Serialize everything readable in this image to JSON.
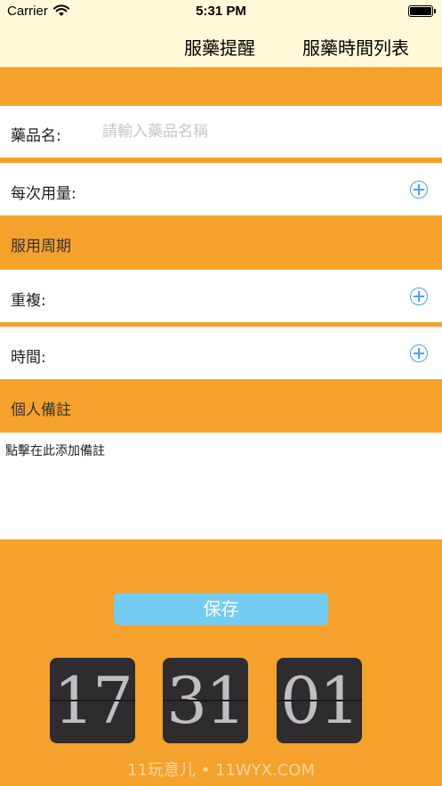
{
  "status_bar": {
    "carrier": "Carrier",
    "time": "5:31 PM"
  },
  "nav": {
    "tab1": "服藥提醒",
    "tab2": "服藥時間列表"
  },
  "form": {
    "name_label": "藥品名:",
    "name_placeholder": "請輸入藥品名稱",
    "name_value": "",
    "dose_label": "每次用量:",
    "period_header": "服用周期",
    "repeat_label": "重複:",
    "time_label": "時間:",
    "notes_header": "個人備註",
    "notes_placeholder": "點擊在此添加備註"
  },
  "save_label": "保存",
  "flip_clock": {
    "hours": "17",
    "minutes": "31",
    "seconds": "01"
  },
  "watermark": "11玩意儿 • 11WYX.COM",
  "colors": {
    "accent": "#f4a22c",
    "nav_bg": "#fff9d9",
    "save_button": "#73cdf3",
    "plus_icon": "#4d9ff5",
    "flip_card": "#2e2c2e"
  }
}
